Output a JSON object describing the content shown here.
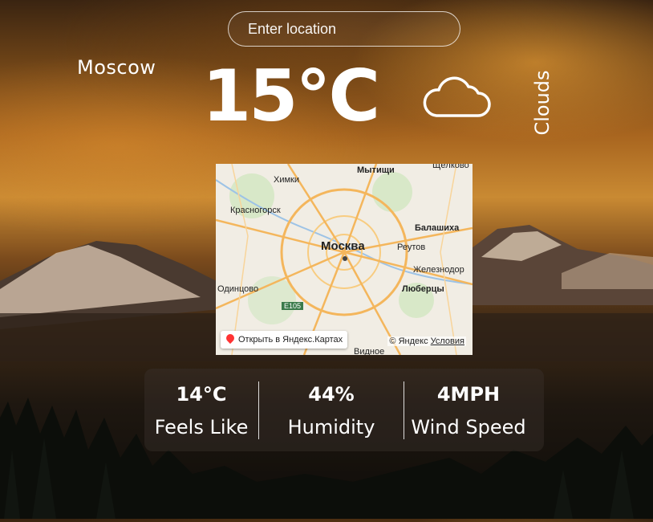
{
  "search": {
    "placeholder": "Enter location"
  },
  "weather": {
    "city": "Moscow",
    "temperature": "15°C",
    "condition": "Clouds",
    "icon": "cloud-icon"
  },
  "map": {
    "labels": {
      "khimki": "Химки",
      "mytishchi": "Мытищи",
      "shchelkovo": "Щёлково",
      "krasnogorsk": "Красногорск",
      "balashikha": "Балашиха",
      "moskva": "Москва",
      "reutov": "Реутов",
      "zheleznodorozhny": "Железнодор",
      "odintsovo": "Одинцово",
      "lyubertsy": "Люберцы",
      "road": "E105",
      "vidnoe": "Видное"
    },
    "open_link": "Открыть в Яндекс.Картах",
    "copyright": "© Яндекс",
    "terms": "Условия"
  },
  "stats": {
    "feels_like": {
      "value": "14°C",
      "label": "Feels Like"
    },
    "humidity": {
      "value": "44%",
      "label": "Humidity"
    },
    "wind": {
      "value": "4MPH",
      "label": "Wind Speed"
    }
  },
  "colors": {
    "text": "#ffffff",
    "accent": "#f2a23a"
  }
}
